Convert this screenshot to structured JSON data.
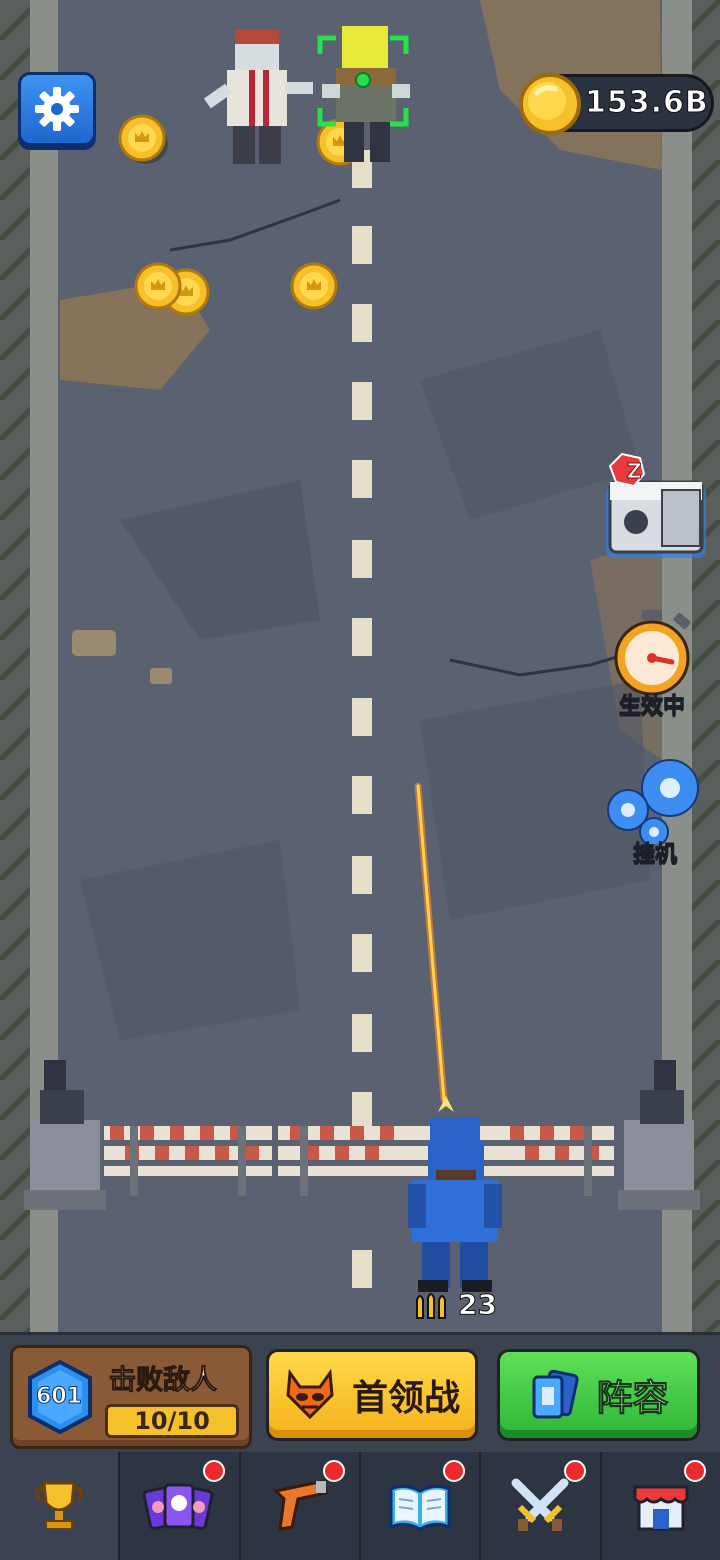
{
  "hud": {
    "coins": "153.6B",
    "settings_icon": "gear-icon",
    "coin_icon": "gold-coin-icon"
  },
  "side_buttons": {
    "chest_badge": "Z",
    "boost_label": "生效中",
    "idle_label": "挂机"
  },
  "player": {
    "ammo": "23"
  },
  "action_bar": {
    "level": "601",
    "kill_title": "击败敌人",
    "kill_progress": "10/10",
    "boss_label": "首领战",
    "team_label": "阵容"
  },
  "bottom_nav": {
    "items": [
      {
        "icon": "trophy-icon",
        "badge": false
      },
      {
        "icon": "heroes-cards-icon",
        "badge": true
      },
      {
        "icon": "pistol-icon",
        "badge": true
      },
      {
        "icon": "book-icon",
        "badge": true
      },
      {
        "icon": "crossed-swords-icon",
        "badge": true
      },
      {
        "icon": "shop-icon",
        "badge": true
      }
    ]
  },
  "colors": {
    "road": "#5a6170",
    "accent_blue": "#2f7fe6",
    "coin_gold": "#f6c02a",
    "tracer": "#ffb52e",
    "badge_red": "#ec2a2a"
  }
}
